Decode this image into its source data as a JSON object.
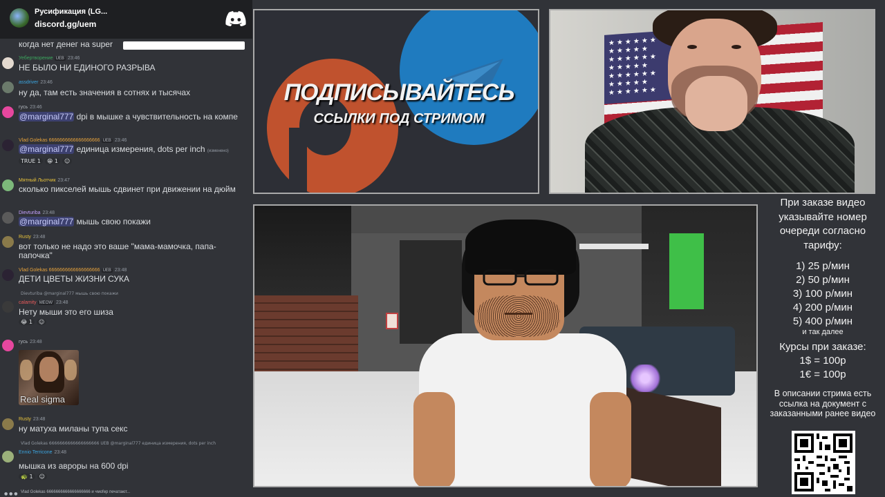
{
  "server": {
    "name": "Русификация (LG...",
    "link": "discord.gg/uem",
    "logo_icon": "discord-logo-icon"
  },
  "chat": {
    "cut_line": "когда нет денег на super",
    "messages": [
      {
        "author": "Уебертворение",
        "author_color": "#3ba55d",
        "badge": "UEB",
        "time": "23:46",
        "text": "НЕ БЫЛО НИ ЕДИНОГО РАЗРЫВА"
      },
      {
        "author": "assdriver",
        "author_color": "#3ba5e0",
        "time": "23:46",
        "text": "ну да, там есть значения в сотнях и тысячах"
      },
      {
        "author": "гусь",
        "author_color": "#b5bac1",
        "time": "23:46",
        "mention": "@marginal777",
        "text": " dpi в мышке а чувствительность на компе"
      },
      {
        "author": "Vlad Golekas 6666666666666666666",
        "author_color": "#e8a33b",
        "badge": "UEB",
        "time": "23:46",
        "mention": "@marginal777",
        "text": " единица измерения, dots per inch",
        "edited": "(изменено)",
        "reactions": [
          "TRUE 1",
          "😁 1",
          "☺"
        ]
      },
      {
        "author": "Мятный Льотчик",
        "author_color": "#e8c33b",
        "time": "23:47",
        "text": "сколько пикселей мышь сдвинет при движении на дюйм"
      },
      {
        "author": "Dievturiba",
        "author_color": "#c4a0ff",
        "time": "23:48",
        "mention": "@marginal777",
        "text": " мышь свою покажи"
      },
      {
        "author": "Rusty",
        "author_color": "#e8c33b",
        "time": "23:48",
        "text": "вот только не надо это ваше \"мама-мамочка, папа-папочка\""
      },
      {
        "author": "Vlad Golekas 6666666666666666666",
        "author_color": "#e8a33b",
        "badge": "UEB",
        "time": "23:48",
        "text": "ДЕТИ ЦВЕТЫ ЖИЗНИ СУКА"
      },
      {
        "reply": "Dievturiba @marginal777 мышь свою покажи",
        "author": "calamity",
        "author_color": "#e85a5a",
        "badge": "MEOW",
        "time": "23:48",
        "text": "Нету мыши это его шиза",
        "reactions": [
          "😂 1",
          "☺"
        ]
      },
      {
        "author": "гусь",
        "author_color": "#b5bac1",
        "time": "23:48",
        "image_label": "Real sigma"
      },
      {
        "author": "Rusty",
        "author_color": "#e8c33b",
        "time": "23:48",
        "text": "ну матуха миланы тупа секс"
      },
      {
        "reply": "Vlad Golekas 6666666666666666666 UEB @marginal777 единица измерения, dots per inch",
        "author": "Ennio Terricone",
        "author_color": "#3ba5e0",
        "time": "23:48",
        "text": "мышка из авроры на 600 dpi",
        "reactions": [
          "🐢 1",
          "☺"
        ]
      }
    ],
    "typing": "Vlad Golekas 6666666666666666666 и чмоfер печатают..."
  },
  "promo": {
    "title": "ПОДПИСЫВАЙТЕСЬ",
    "subtitle": "ССЫЛКИ ПОД СТРИМОМ"
  },
  "sidebar": {
    "header": "При заказе видео указывайте номер очереди согласно тарифу:",
    "tiers": [
      "1) 25 р/мин",
      "2) 50 р/мин",
      "3) 100 р/мин",
      "4) 200 р/мин",
      "5) 400 р/мин"
    ],
    "tiers_note": "и так далее",
    "rates_title": "Курсы при заказе:",
    "rates": [
      "1$ = 100р",
      "1€ = 100р"
    ],
    "description": "В описании стрима есть ссылка на документ с заказанными ранее видео"
  }
}
